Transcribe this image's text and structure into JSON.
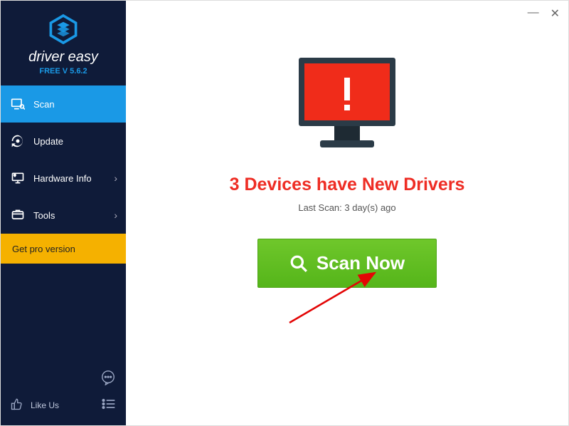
{
  "brand": {
    "name": "driver easy",
    "version": "FREE V 5.6.2"
  },
  "nav": {
    "scan": "Scan",
    "update": "Update",
    "hardware": "Hardware Info",
    "tools": "Tools"
  },
  "pro_label": "Get pro version",
  "like_label": "Like Us",
  "main": {
    "headline": "3 Devices have New Drivers",
    "last_scan": "Last Scan: 3 day(s) ago",
    "scan_button": "Scan Now"
  },
  "window": {
    "minimize": "—",
    "close": "✕"
  }
}
